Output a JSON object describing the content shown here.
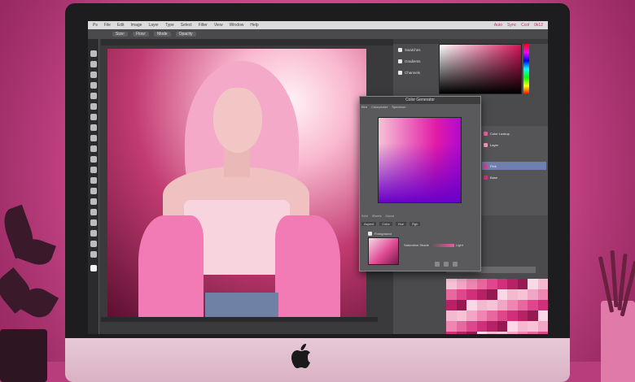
{
  "menubar": {
    "items": [
      "Ps",
      "File",
      "Edit",
      "Image",
      "Layer",
      "Type",
      "Select",
      "Filter",
      "View",
      "Window",
      "Help"
    ],
    "status": [
      "Auto",
      "Sync",
      "Ccol",
      "0k12"
    ]
  },
  "optionsbar": {
    "chips": [
      "Size:",
      "Flow:",
      "Mode",
      "Opacity"
    ]
  },
  "right_panel": {
    "rows": [
      "Swatches",
      "Gradients",
      "Channels"
    ],
    "layers": [
      "Color Lookup",
      "Layer",
      "Pink",
      "Base"
    ]
  },
  "dialog": {
    "title": "Color Generator",
    "tabs": [
      "Bird",
      "Colorpicker",
      "Spectrum"
    ],
    "separators": [
      "Solid",
      "Wheels",
      "Gamut"
    ],
    "options": [
      "Aspect",
      "Color",
      "Hue",
      "Rgb"
    ],
    "sub": "Foreground",
    "slider_label": "Saturation",
    "slider_secondary": "Shade",
    "value": "Light"
  },
  "colors": {
    "accent": "#e21aa6",
    "screen": "#3a3a3c",
    "panel": "#4b4b4d"
  }
}
